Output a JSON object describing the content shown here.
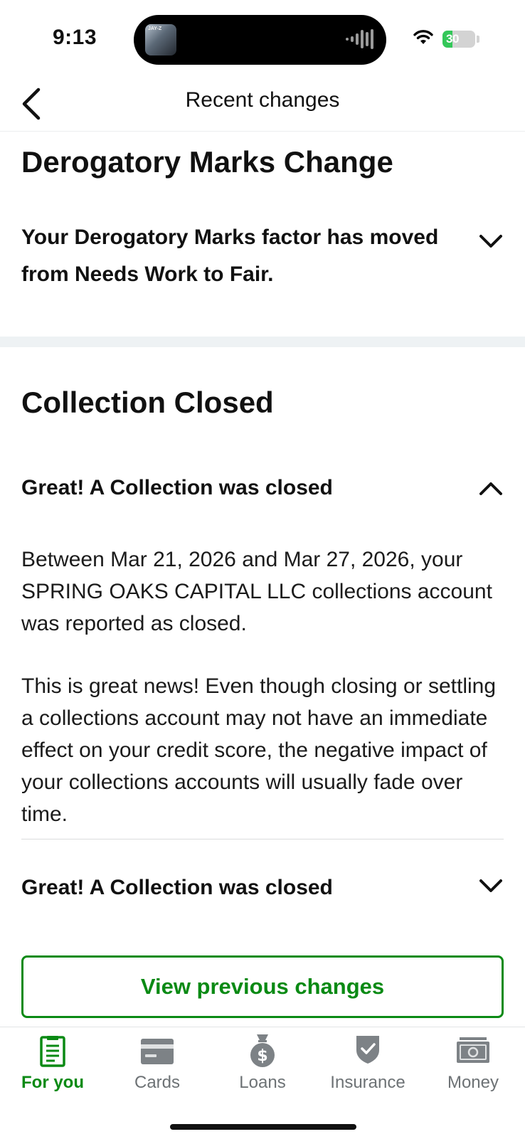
{
  "status_bar": {
    "time": "9:13",
    "island_art_text": "JAY-Z",
    "battery": "30"
  },
  "nav": {
    "title": "Recent changes"
  },
  "derogatory": {
    "title": "Derogatory Marks Change",
    "summary": "Your Derogatory Marks factor has moved from Needs Work to Fair."
  },
  "collection": {
    "title": "Collection Closed",
    "items": [
      {
        "header": "Great! A Collection was closed",
        "expanded": true,
        "paragraph1": "Between Mar 21, 2026 and Mar 27, 2026, your SPRING OAKS CAPITAL LLC collections account was reported as closed.",
        "paragraph2": "This is great news! Even though closing or settling a collections account may not have an immediate effect on your credit score, the negative impact of your collections accounts will usually fade over time."
      },
      {
        "header": "Great! A Collection was closed",
        "expanded": false
      }
    ]
  },
  "actions": {
    "view_previous": "View previous changes"
  },
  "tabs": [
    {
      "label": "For you",
      "icon": "document-icon",
      "active": true
    },
    {
      "label": "Cards",
      "icon": "card-icon",
      "active": false
    },
    {
      "label": "Loans",
      "icon": "money-bag-icon",
      "active": false
    },
    {
      "label": "Insurance",
      "icon": "shield-icon",
      "active": false
    },
    {
      "label": "Money",
      "icon": "banknote-icon",
      "active": false
    }
  ],
  "colors": {
    "brand_green": "#0a8a14",
    "tab_gray": "#6d7275",
    "divider": "#eef2f4"
  }
}
